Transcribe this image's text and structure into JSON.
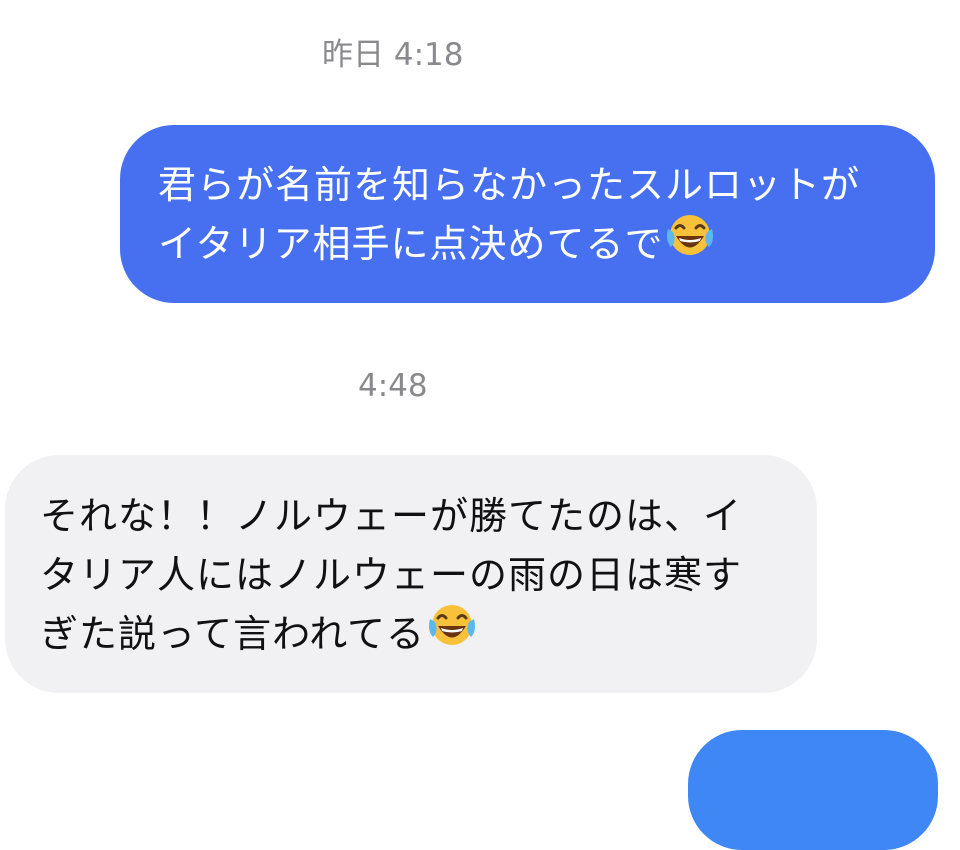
{
  "conversation": {
    "timestamp_1": "昨日 4:18",
    "message_1": {
      "direction": "outgoing",
      "text": "君らが名前を知らなかったスルロットがイタリア相手に点決めてるで",
      "emoji": "face-with-tears-of-joy"
    },
    "timestamp_2": "4:48",
    "message_2": {
      "direction": "incoming",
      "text": "それな！！ノルウェーが勝てたのは、イタリア人にはノルウェーの雨の日は寒すぎた説って言われてる",
      "emoji": "face-with-tears-of-joy"
    },
    "message_3": {
      "direction": "outgoing",
      "text": ""
    }
  },
  "colors": {
    "outgoing_bubble": "#4770f1",
    "incoming_bubble": "#f1f1f3",
    "timestamp_text": "#8a8a8e",
    "partial_bubble": "#3f87f5"
  }
}
